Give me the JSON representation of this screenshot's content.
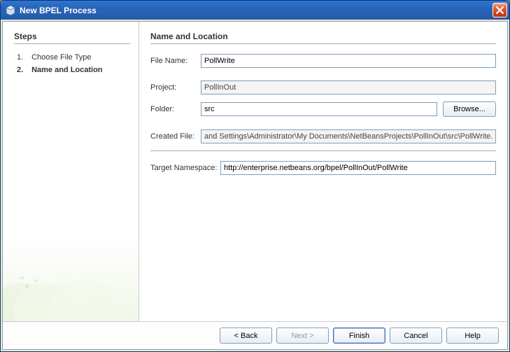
{
  "window": {
    "title": "New BPEL Process"
  },
  "sidebar": {
    "heading": "Steps",
    "steps": [
      {
        "num": "1.",
        "label": "Choose File Type",
        "active": false
      },
      {
        "num": "2.",
        "label": "Name and Location",
        "active": true
      }
    ]
  },
  "form": {
    "heading": "Name and Location",
    "file_name_label": "File Name:",
    "file_name_value": "PollWrite",
    "project_label": "Project:",
    "project_value": "PollInOut",
    "folder_label": "Folder:",
    "folder_value": "src",
    "browse_label": "Browse...",
    "created_label": "Created File:",
    "created_value": "and Settings\\Administrator\\My Documents\\NetBeansProjects\\PollInOut\\src\\PollWrite.bpel",
    "namespace_label": "Target Namespace:",
    "namespace_value": "http://enterprise.netbeans.org/bpel/PollInOut/PollWrite"
  },
  "buttons": {
    "back": "< Back",
    "next": "Next >",
    "finish": "Finish",
    "cancel": "Cancel",
    "help": "Help"
  }
}
